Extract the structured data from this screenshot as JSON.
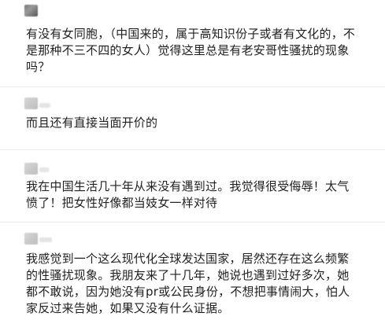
{
  "comments": [
    {
      "text": "有没有女同胞，（中国来的，属于高知识份子或者有文化的，不是那种不三不四的女人）觉得这里总是有老安哥性骚扰的现象吗？"
    },
    {
      "text": "而且还有直接当面开价的"
    },
    {
      "text": "我在中国生活几十年从来没有遇到过。我觉得很受侮辱！太气愤了！把女性好像都当妓女一样对待"
    },
    {
      "text": "我感觉到一个这么现代化全球发达国家，居然还存在这么频繁的性骚扰现象。我朋友来了十几年，她说也遇到过好多次，她都不敢说，因为她没有pr或公民身份，不想把事情闹大，怕人家反过来告她，如果又没有什么证据。"
    }
  ]
}
